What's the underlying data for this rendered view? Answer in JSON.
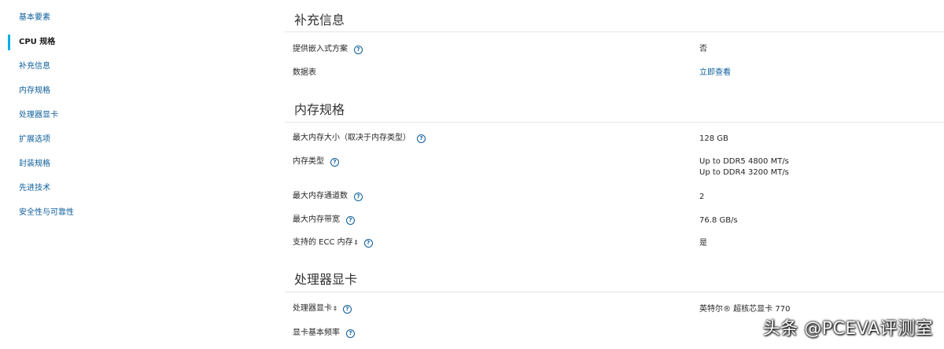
{
  "sidebar": {
    "items": [
      {
        "label": "基本要素"
      },
      {
        "label": "CPU 规格"
      },
      {
        "label": "补充信息"
      },
      {
        "label": "内存规格"
      },
      {
        "label": "处理器显卡"
      },
      {
        "label": "扩展选项"
      },
      {
        "label": "封装规格"
      },
      {
        "label": "先进技术"
      },
      {
        "label": "安全性与可靠性"
      }
    ]
  },
  "sections": {
    "supplemental": {
      "title": "补充信息",
      "rows": [
        {
          "label": "提供嵌入式方案",
          "value": "否"
        },
        {
          "label": "数据表",
          "value": "立即查看"
        }
      ]
    },
    "memory": {
      "title": "内存规格",
      "rows": [
        {
          "label": "最大内存大小（取决于内存类型）",
          "value": "128 GB"
        },
        {
          "label": "内存类型",
          "value_lines": [
            "Up to DDR5 4800 MT/s",
            "Up to DDR4 3200 MT/s"
          ]
        },
        {
          "label": "最大内存通道数",
          "value": "2"
        },
        {
          "label": "最大内存带宽",
          "value": "76.8 GB/s"
        },
        {
          "label": "支持的 ECC 内存",
          "sup": "‡",
          "value": "是"
        }
      ]
    },
    "graphics": {
      "title": "处理器显卡",
      "rows": [
        {
          "label": "处理器显卡",
          "sup": "‡",
          "value": "英特尔® 超核芯显卡 770"
        },
        {
          "label": "显卡基本频率",
          "value": ""
        }
      ]
    }
  },
  "help_glyph": "?",
  "watermark": "头条 @PCEVA评测室",
  "colors": {
    "link": "#0b5e9b",
    "active_marker": "#00aeef",
    "text": "#262626"
  }
}
